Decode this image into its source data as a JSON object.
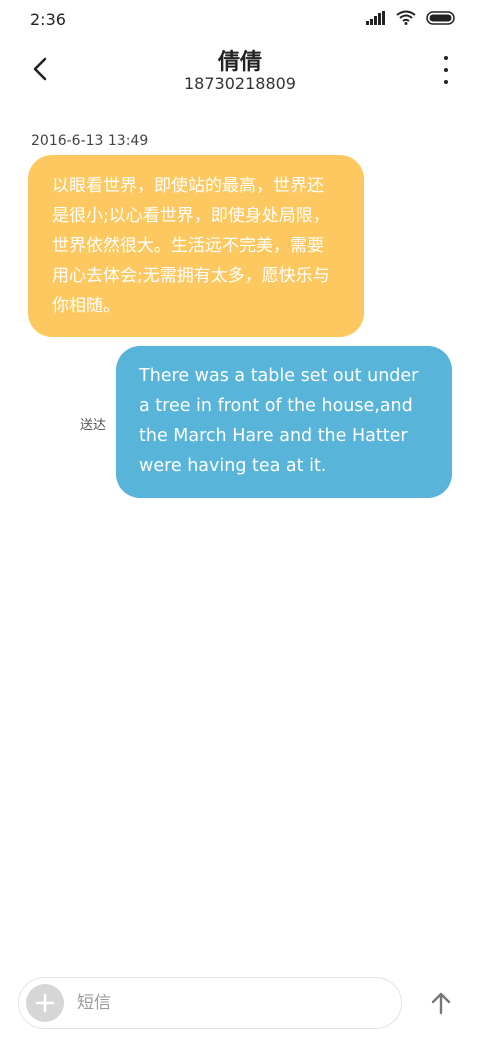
{
  "status_bar": {
    "time": "2:36",
    "icons": [
      "signal-icon",
      "wifi-icon",
      "battery-icon"
    ]
  },
  "header": {
    "back_icon": "chevron-left-icon",
    "contact_name": "倩倩",
    "contact_number": "18730218809",
    "more_icon": "more-vertical-icon"
  },
  "conversation": {
    "timestamp": "2016-6-13 13:49",
    "messages": [
      {
        "direction": "incoming",
        "text": "以眼看世界，即使站的最高，世界还是很小;以心看世界，即使身处局限，世界依然很大。生活远不完美，需要用心去体会;无需拥有太多，愿快乐与你相随。",
        "color": "#fdc85f"
      },
      {
        "direction": "outgoing",
        "text": "There was a table set out under a tree in front of the house,and the March Hare and the Hatter were having tea at it.",
        "status": "送达",
        "color": "#58b4d8"
      }
    ]
  },
  "composer": {
    "add_icon": "plus-icon",
    "placeholder": "短信",
    "value": "",
    "send_icon": "arrow-up-icon"
  }
}
